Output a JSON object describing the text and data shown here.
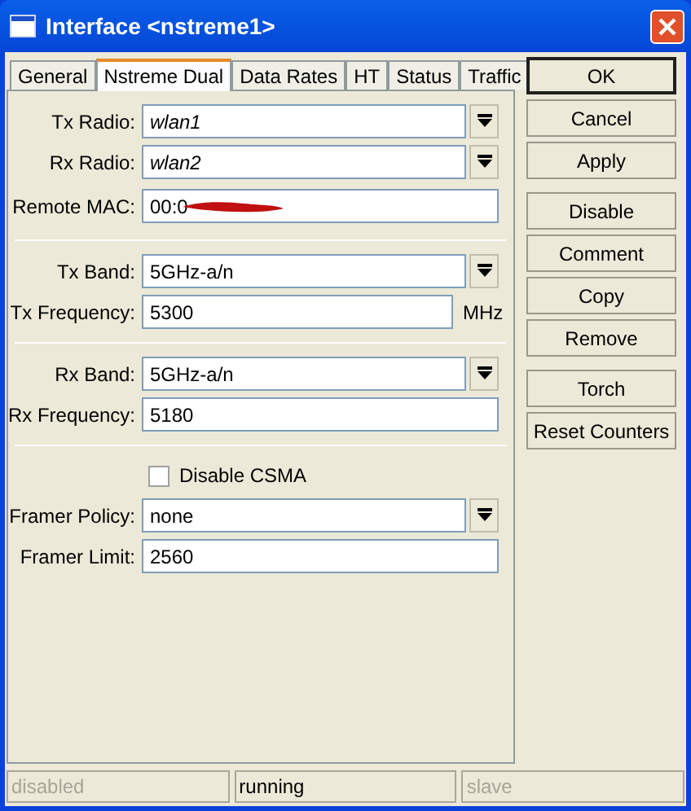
{
  "window": {
    "title": "Interface <nstreme1>"
  },
  "tabs": [
    {
      "label": "General",
      "selected": false
    },
    {
      "label": "Nstreme Dual",
      "selected": true
    },
    {
      "label": "Data Rates",
      "selected": false
    },
    {
      "label": "HT",
      "selected": false
    },
    {
      "label": "Status",
      "selected": false
    },
    {
      "label": "Traffic",
      "selected": false
    }
  ],
  "fields": [
    {
      "kind": "combo",
      "label": "Tx Radio:",
      "value": "wlan1",
      "italic": true
    },
    {
      "kind": "combo",
      "label": "Rx Radio:",
      "value": "wlan2",
      "italic": true
    },
    {
      "kind": "redacted",
      "label": "Remote MAC:",
      "value": "00:0",
      "italic": false
    },
    {
      "kind": "separator"
    },
    {
      "kind": "combo",
      "label": "Tx Band:",
      "value": "5GHz-a/n",
      "italic": false
    },
    {
      "kind": "unit",
      "label": "Tx Frequency:",
      "value": "5300",
      "unit": "MHz",
      "italic": false
    },
    {
      "kind": "separator"
    },
    {
      "kind": "combo",
      "label": "Rx Band:",
      "value": "5GHz-a/n",
      "italic": false
    },
    {
      "kind": "text",
      "label": "Rx Frequency:",
      "value": "5180",
      "italic": false
    },
    {
      "kind": "separator"
    },
    {
      "kind": "checkbox",
      "label": "Disable CSMA",
      "checked": false
    },
    {
      "kind": "combo",
      "label": "Framer Policy:",
      "value": "none",
      "italic": false
    },
    {
      "kind": "text",
      "label": "Framer Limit:",
      "value": "2560",
      "italic": false
    }
  ],
  "button_groups": [
    [
      {
        "label": "OK",
        "default": true
      },
      {
        "label": "Cancel",
        "default": false
      },
      {
        "label": "Apply",
        "default": false
      }
    ],
    [
      {
        "label": "Disable",
        "default": false
      },
      {
        "label": "Comment",
        "default": false
      },
      {
        "label": "Copy",
        "default": false
      },
      {
        "label": "Remove",
        "default": false
      }
    ],
    [
      {
        "label": "Torch",
        "default": false
      },
      {
        "label": "Reset Counters",
        "default": false
      }
    ]
  ],
  "status_bar": [
    {
      "text": "disabled",
      "disabled": true
    },
    {
      "text": "running",
      "disabled": false
    },
    {
      "text": "slave",
      "disabled": true
    }
  ]
}
